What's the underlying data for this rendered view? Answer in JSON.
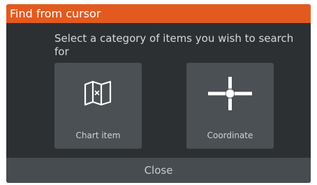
{
  "dialog": {
    "title": "Find from cursor",
    "prompt": "Select a category of items you wish to search for",
    "options": [
      {
        "label": "Chart item",
        "icon": "map-icon"
      },
      {
        "label": "Coordinate",
        "icon": "crosshair-icon"
      }
    ],
    "close_label": "Close"
  },
  "colors": {
    "title_bar": "#e35a1f",
    "dialog_background": "#2d3033",
    "tile_background": "#4a5054",
    "close_bar": "#464c50"
  }
}
